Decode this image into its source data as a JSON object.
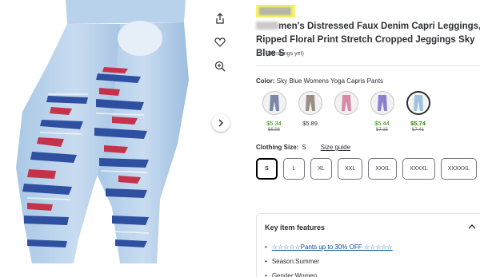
{
  "product": {
    "title_visible": "men's Distressed Faux Denim Capri Leggings, Ripped Floral Print Stretch Cropped Jeggings Sky Blue S",
    "rating_text": "(No ratings yet)"
  },
  "actions": {
    "share_icon": "share-icon",
    "favorite_icon": "heart-icon",
    "zoom_icon": "zoom-in-icon",
    "next_icon": "chevron-right-icon"
  },
  "color": {
    "label": "Color:",
    "selected_value": "Sky Blue Womens Yoga Capris Pants",
    "swatches": [
      {
        "price": "$5.34",
        "was": "$6.98",
        "sale": true,
        "tint": "#7b86a8"
      },
      {
        "price": "$5.89",
        "was": "",
        "sale": false,
        "tint": "#9a8f84"
      },
      {
        "price": "",
        "was": "",
        "sale": false,
        "tint": "#d889a7"
      },
      {
        "price": "$5.44",
        "was": "$7.15",
        "sale": true,
        "tint": "#8c7fd0"
      },
      {
        "price": "$5.74",
        "was": "$7.41",
        "sale": true,
        "tint": "#9fc3df"
      }
    ]
  },
  "size": {
    "label": "Clothing Size:",
    "selected_value": "S",
    "guide_label": "Size guide",
    "options": [
      "S",
      "L",
      "XL",
      "XXL",
      "XXXL",
      "XXXXL",
      "XXXXXL"
    ]
  },
  "features": {
    "heading": "Key item features",
    "items": [
      {
        "text": "☆☆☆☆☆Pants up to 30% OFF ☆☆☆☆☆",
        "link": true
      },
      {
        "text": "Season:Summer",
        "link": false
      },
      {
        "text": "Gender:Women",
        "link": false
      }
    ]
  },
  "colors": {
    "sale_green": "#2a8703",
    "link_blue": "#004f9a",
    "brand_highlight": "#f4f26a"
  }
}
